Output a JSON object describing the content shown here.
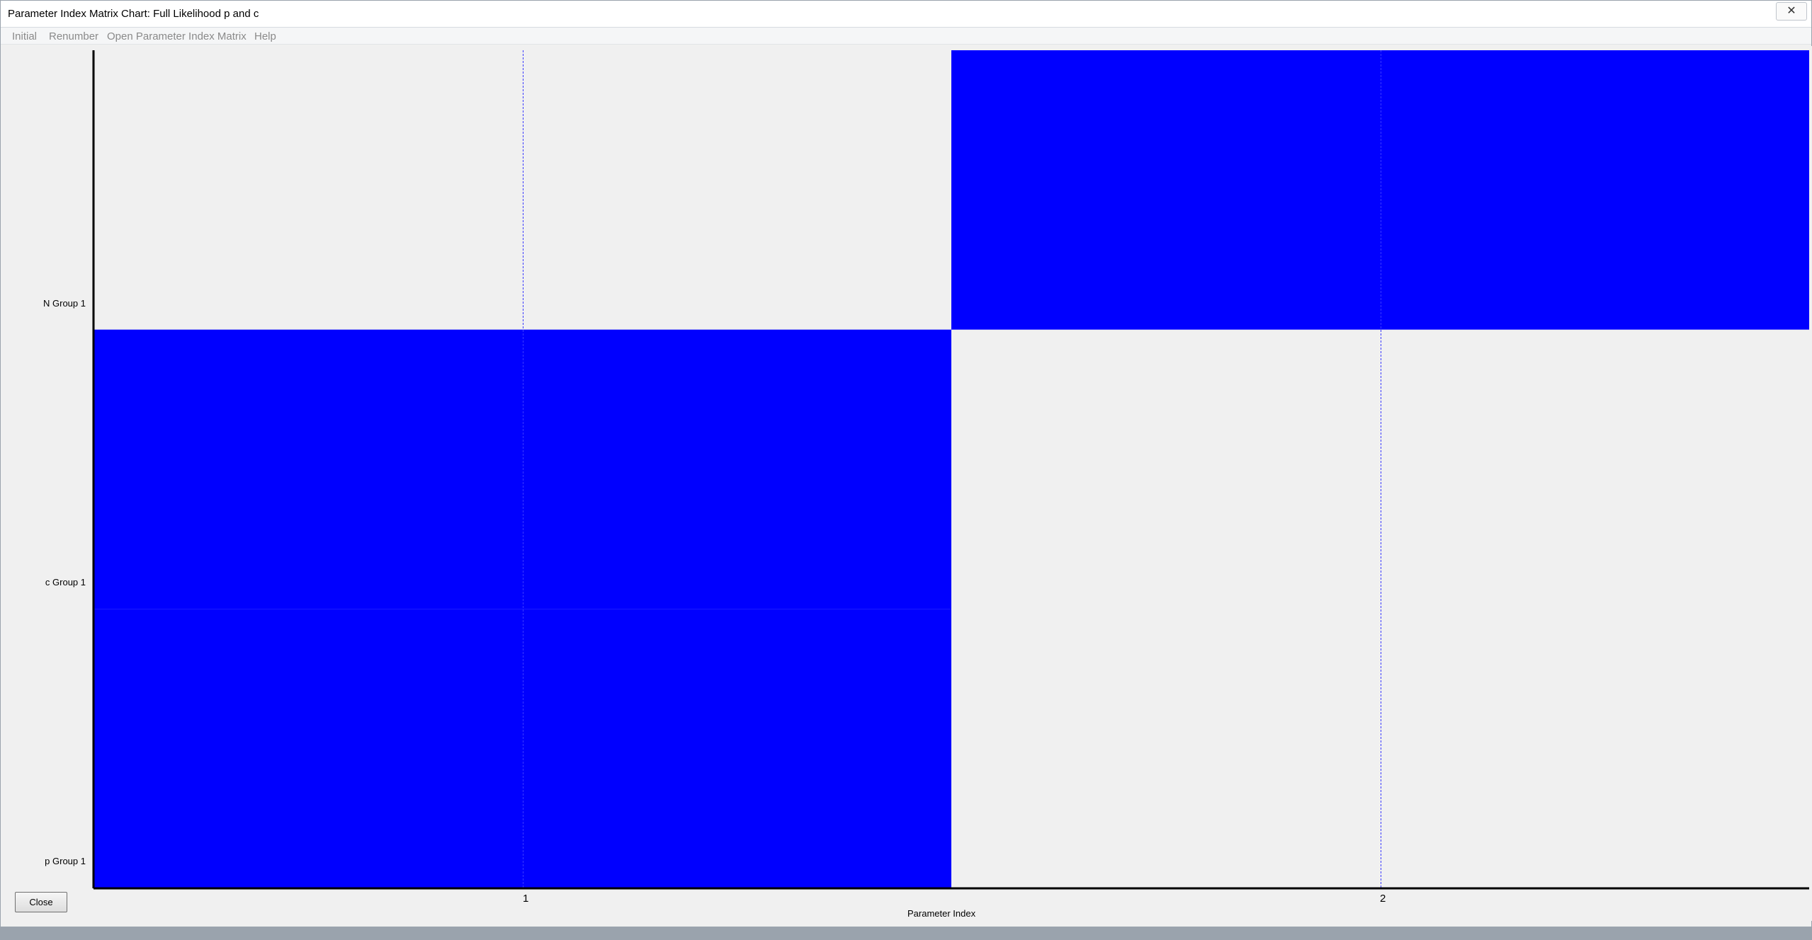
{
  "window": {
    "title": "Parameter Index Matrix Chart: Full Likelihood p and c",
    "close_glyph": "✕"
  },
  "menu": {
    "items": [
      "Initial",
      "Renumber",
      "Open Parameter Index Matrix",
      "Help"
    ]
  },
  "footer": {
    "close_label": "Close"
  },
  "colors": {
    "fill": "#0000ff",
    "background": "#f0f0f0",
    "gridline": "#3a3aff"
  },
  "chart_data": {
    "type": "heatmap",
    "xlabel": "Parameter Index",
    "ylabel": "",
    "x_ticks": [
      "1",
      "2"
    ],
    "y_categories": [
      "p Group 1",
      "c Group 1",
      "N Group 1"
    ],
    "cells": [
      {
        "row": "p Group 1",
        "x_range": [
          0.5,
          1.5
        ],
        "filled": true
      },
      {
        "row": "c Group 1",
        "x_range": [
          0.5,
          1.5
        ],
        "filled": true
      },
      {
        "row": "N Group 1",
        "x_range": [
          1.5,
          2.5
        ],
        "filled": true
      }
    ],
    "xlim": [
      0.5,
      2.5
    ],
    "grid": "vertical dashed lines at tick positions"
  }
}
